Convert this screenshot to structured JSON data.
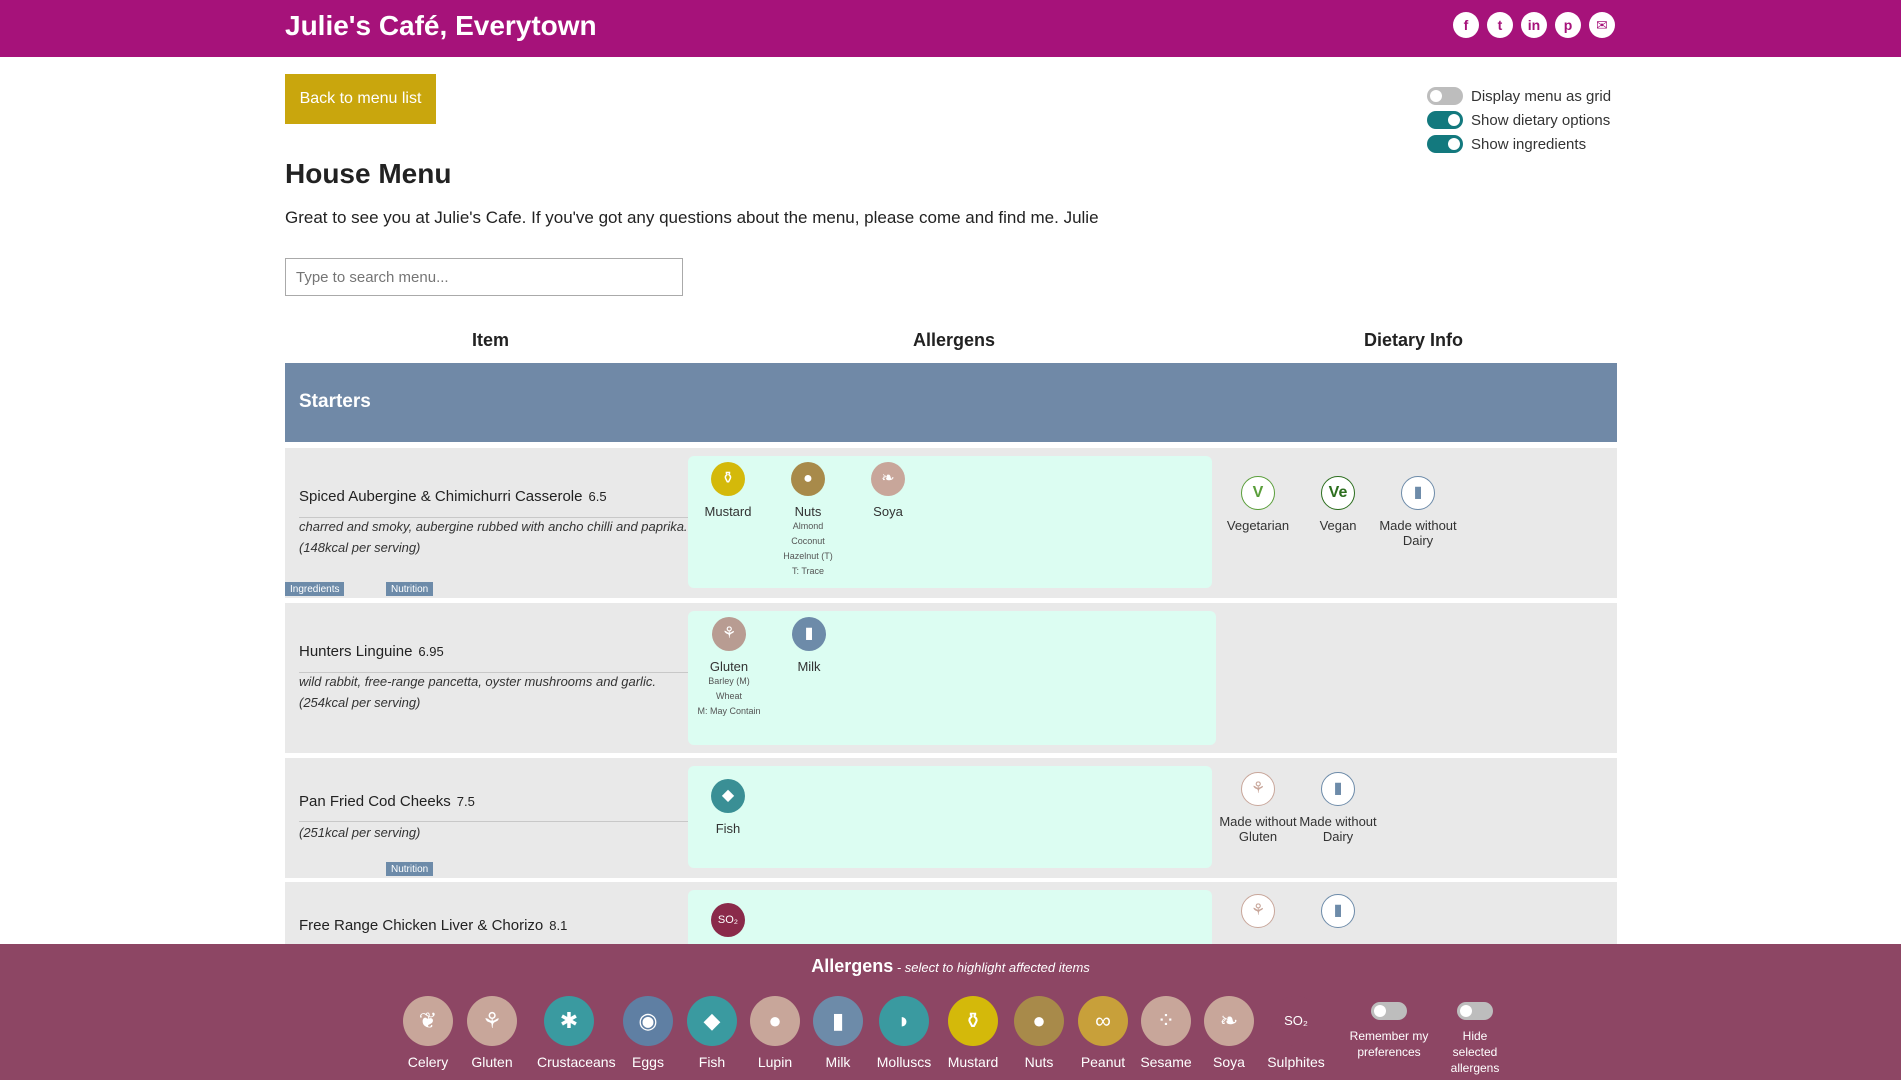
{
  "header": {
    "title": "Julie's Café, Everytown",
    "social_icons": [
      "facebook-icon",
      "twitter-icon",
      "linkedin-icon",
      "pinterest-icon",
      "email-icon"
    ]
  },
  "back_label": "Back to menu list",
  "toggles": [
    {
      "label": "Display menu as grid",
      "on": false
    },
    {
      "label": "Show dietary options",
      "on": true
    },
    {
      "label": "Show ingredients",
      "on": true
    }
  ],
  "page_title": "House Menu",
  "intro": "Great to see you at Julie's Cafe. If you've got any questions about the menu, please come and find me. Julie",
  "search": {
    "placeholder": "Type to search menu..."
  },
  "columns": {
    "item": "Item",
    "allergens": "Allergens",
    "dietary": "Dietary Info"
  },
  "section": "Starters",
  "items": [
    {
      "name": "Spiced Aubergine & Chimichurri Casserole",
      "price": "6.5",
      "description": "charred and smoky, aubergine rubbed with ancho chilli and paprika. (148kcal per serving)",
      "tags": [
        "Ingredients",
        "Nutrition"
      ],
      "allergens": [
        {
          "label": "Mustard",
          "icon": "mustard-icon",
          "color": "#d4b90a",
          "sub": []
        },
        {
          "label": "Nuts",
          "icon": "nuts-icon",
          "color": "#a88a4a",
          "sub": [
            "Almond",
            "Coconut",
            "Hazelnut (T)",
            "T: Trace"
          ]
        },
        {
          "label": "Soya",
          "icon": "soya-icon",
          "color": "#c8a69a",
          "sub": []
        }
      ],
      "dietary": [
        {
          "label": "Vegetarian",
          "icon": "vegetarian-icon",
          "symbol": "V",
          "color": "#5a9e3a"
        },
        {
          "label": "Vegan",
          "icon": "vegan-icon",
          "symbol": "Ve",
          "color": "#2c6e1e"
        },
        {
          "label": "Made without Dairy",
          "icon": "no-dairy-icon",
          "symbol": "▮",
          "color": "#6d8ba9"
        }
      ]
    },
    {
      "name": "Hunters Linguine",
      "price": "6.95",
      "description": "wild rabbit, free-range pancetta, oyster mushrooms and garlic. (254kcal per serving)",
      "tags": [],
      "allergens": [
        {
          "label": "Gluten",
          "icon": "gluten-icon",
          "color": "#b89c92",
          "sub": [
            "Barley (M)",
            "Wheat",
            "M: May Contain"
          ]
        },
        {
          "label": "Milk",
          "icon": "milk-icon",
          "color": "#6d8ba9",
          "sub": []
        }
      ],
      "dietary": []
    },
    {
      "name": "Pan Fried Cod Cheeks",
      "price": "7.5",
      "description": "(251kcal per serving)",
      "tags": [
        "Nutrition"
      ],
      "allergens": [
        {
          "label": "Fish",
          "icon": "fish-icon",
          "color": "#3a8f95",
          "sub": []
        }
      ],
      "dietary": [
        {
          "label": "Made without Gluten",
          "icon": "no-gluten-icon",
          "symbol": "⚘",
          "color": "#c8a69a"
        },
        {
          "label": "Made without Dairy",
          "icon": "no-dairy-icon",
          "symbol": "▮",
          "color": "#6d8ba9"
        }
      ]
    },
    {
      "name": "Free Range Chicken Liver & Chorizo",
      "price": "8.1",
      "description": "",
      "tags": [],
      "allergens": [
        {
          "label": "",
          "icon": "sulphites-icon",
          "color": "#8a2a4a",
          "sub": []
        }
      ],
      "dietary": [
        {
          "label": "",
          "icon": "no-gluten-icon",
          "symbol": "⚘",
          "color": "#c8a69a"
        },
        {
          "label": "",
          "icon": "no-dairy-icon",
          "symbol": "▮",
          "color": "#6d8ba9"
        }
      ]
    }
  ],
  "footer": {
    "title": "Allergens",
    "subtitle": " - select to highlight affected items",
    "allergens": [
      {
        "label": "Celery",
        "icon": "celery-icon",
        "color": "#c8a69a"
      },
      {
        "label": "Gluten",
        "icon": "gluten-icon",
        "color": "#c8a69a"
      },
      {
        "label": "Crustaceans",
        "icon": "crustaceans-icon",
        "color": "#3a9aa0"
      },
      {
        "label": "Eggs",
        "icon": "eggs-icon",
        "color": "#5f7fa3"
      },
      {
        "label": "Fish",
        "icon": "fish-icon",
        "color": "#3a9aa0"
      },
      {
        "label": "Lupin",
        "icon": "lupin-icon",
        "color": "#c8a69a"
      },
      {
        "label": "Milk",
        "icon": "milk-icon",
        "color": "#6d8ba9"
      },
      {
        "label": "Molluscs",
        "icon": "molluscs-icon",
        "color": "#3a9aa0"
      },
      {
        "label": "Mustard",
        "icon": "mustard-icon",
        "color": "#d4b90a"
      },
      {
        "label": "Nuts",
        "icon": "nuts-icon",
        "color": "#a88a4a"
      },
      {
        "label": "Peanut",
        "icon": "peanut-icon",
        "color": "#c8a03a"
      },
      {
        "label": "Sesame",
        "icon": "sesame-icon",
        "color": "#c8a69a"
      },
      {
        "label": "Soya",
        "icon": "soya-icon",
        "color": "#c8a69a"
      },
      {
        "label": "Sulphites",
        "icon": "sulphites-icon",
        "color": "#8d4664"
      }
    ],
    "toggles": [
      {
        "label": "Remember my preferences",
        "on": false
      },
      {
        "label": "Hide selected allergens",
        "on": false
      }
    ]
  }
}
